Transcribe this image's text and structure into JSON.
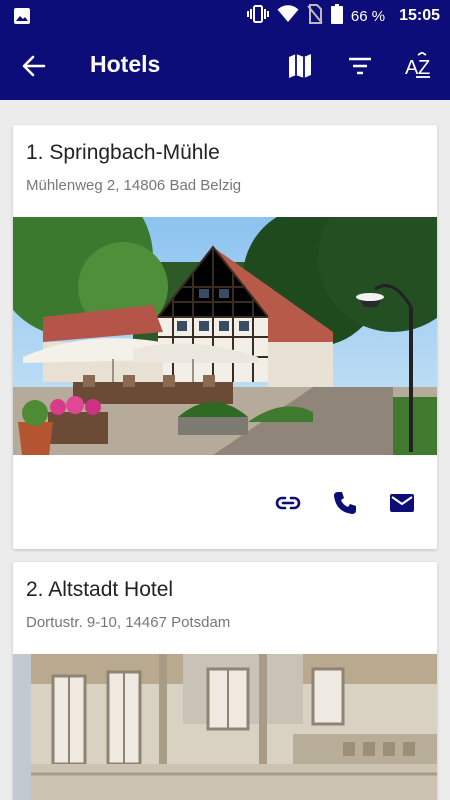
{
  "status_bar": {
    "battery_percent": "66 %",
    "time": "15:05",
    "icons": [
      "image-notification-icon",
      "vibrate-icon",
      "wifi-icon",
      "no-sim-icon",
      "battery-icon"
    ]
  },
  "app_bar": {
    "title": "Hotels",
    "icons": [
      "back-arrow-icon",
      "map-icon",
      "filter-icon",
      "sort-az-icon"
    ]
  },
  "hotels": [
    {
      "name": "1. Springbach-Mühle",
      "address": "Mühlenweg 2, 14806 Bad Belzig",
      "actions": [
        "link-icon",
        "phone-icon",
        "mail-icon"
      ]
    },
    {
      "name": "2. Altstadt Hotel",
      "address": "Dortustr. 9-10, 14467 Potsdam"
    }
  ],
  "colors": {
    "primary": "#0d0d7a",
    "background": "#ececec",
    "card": "#ffffff",
    "title_text": "#222222",
    "secondary_text": "#777777"
  }
}
